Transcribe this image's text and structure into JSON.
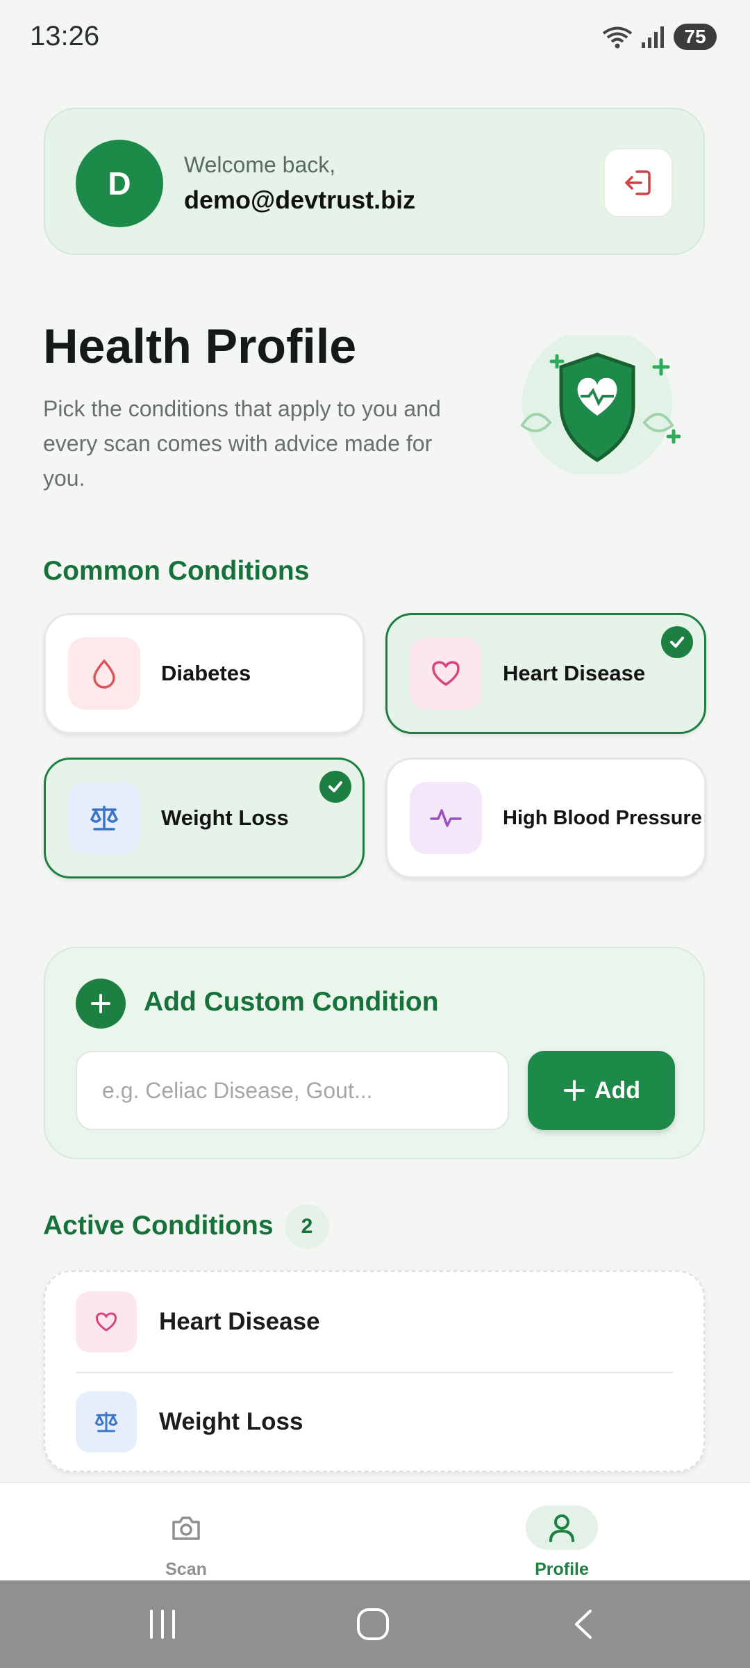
{
  "status": {
    "time": "13:26",
    "battery": "75"
  },
  "welcome": {
    "avatar_initial": "D",
    "greeting": "Welcome back,",
    "email": "demo@devtrust.biz"
  },
  "hero": {
    "title": "Health Profile",
    "subtitle": "Pick the conditions that apply to you and every scan comes with advice made for you."
  },
  "common": {
    "title": "Common Conditions",
    "items": [
      {
        "label": "Diabetes",
        "selected": false
      },
      {
        "label": "Heart Disease",
        "selected": true
      },
      {
        "label": "Weight Loss",
        "selected": true
      },
      {
        "label": "High Blood Pressure",
        "selected": false
      }
    ]
  },
  "custom": {
    "title": "Add Custom Condition",
    "placeholder": "e.g. Celiac Disease, Gout...",
    "add_label": "Add"
  },
  "active": {
    "title": "Active Conditions",
    "count": "2",
    "items": [
      {
        "label": "Heart Disease"
      },
      {
        "label": "Weight Loss"
      }
    ]
  },
  "nav": {
    "scan_label": "Scan",
    "profile_label": "Profile",
    "active_tab": "Profile"
  },
  "colors": {
    "primary": "#1e8a49",
    "primary_dark": "#17713a",
    "selected_bg": "#e6f3e9",
    "diabetes_icon": "#d9545b",
    "heart_icon": "#d6457e",
    "weight_icon": "#3b73c6",
    "pressure_icon": "#9c4fbf",
    "logout_icon": "#d04345"
  }
}
